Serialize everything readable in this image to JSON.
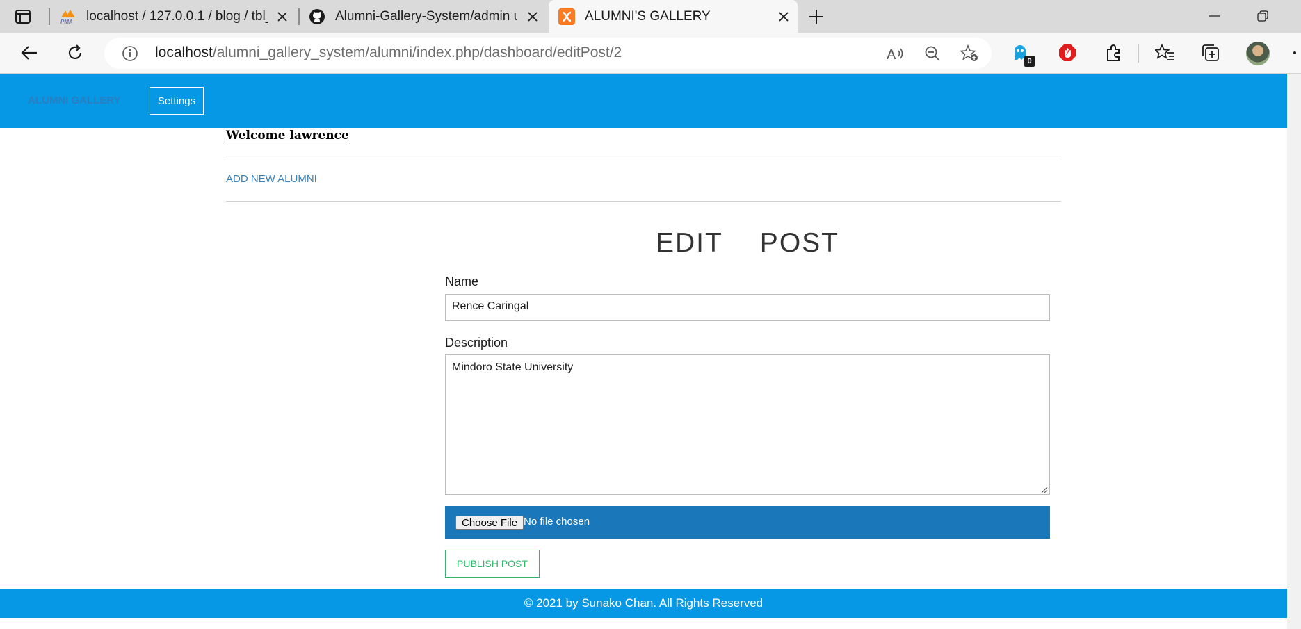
{
  "browser": {
    "tabs": [
      {
        "title": "localhost / 127.0.0.1 / blog / tbl_",
        "icon": "phpmyadmin-icon"
      },
      {
        "title": "Alumni-Gallery-System/admin us",
        "icon": "github-icon"
      },
      {
        "title": "ALUMNI'S GALLERY",
        "icon": "xampp-icon"
      }
    ],
    "address": {
      "host": "localhost",
      "path": "/alumni_gallery_system/alumni/index.php/dashboard/editPost/2"
    },
    "extension_badge": "0"
  },
  "navbar": {
    "brand": "ALUMNI GALLERY",
    "settings_label": "Settings"
  },
  "page": {
    "welcome": "Welcome lawrence",
    "add_link": "ADD NEW ALUMNI",
    "title": "EDIT  POST",
    "form": {
      "name_label": "Name",
      "name_value": "Rence Caringal",
      "description_label": "Description",
      "description_value": "Mindoro State University",
      "file_button": "Choose File",
      "file_status": "No file chosen",
      "publish_label": "PUBLISH POST"
    }
  },
  "footer": {
    "text": "© 2021 by Sunako Chan. All Rights Reserved"
  },
  "colors": {
    "primary": "#0698e4",
    "file_bar": "#1a77b9",
    "publish": "#2cb96a"
  }
}
